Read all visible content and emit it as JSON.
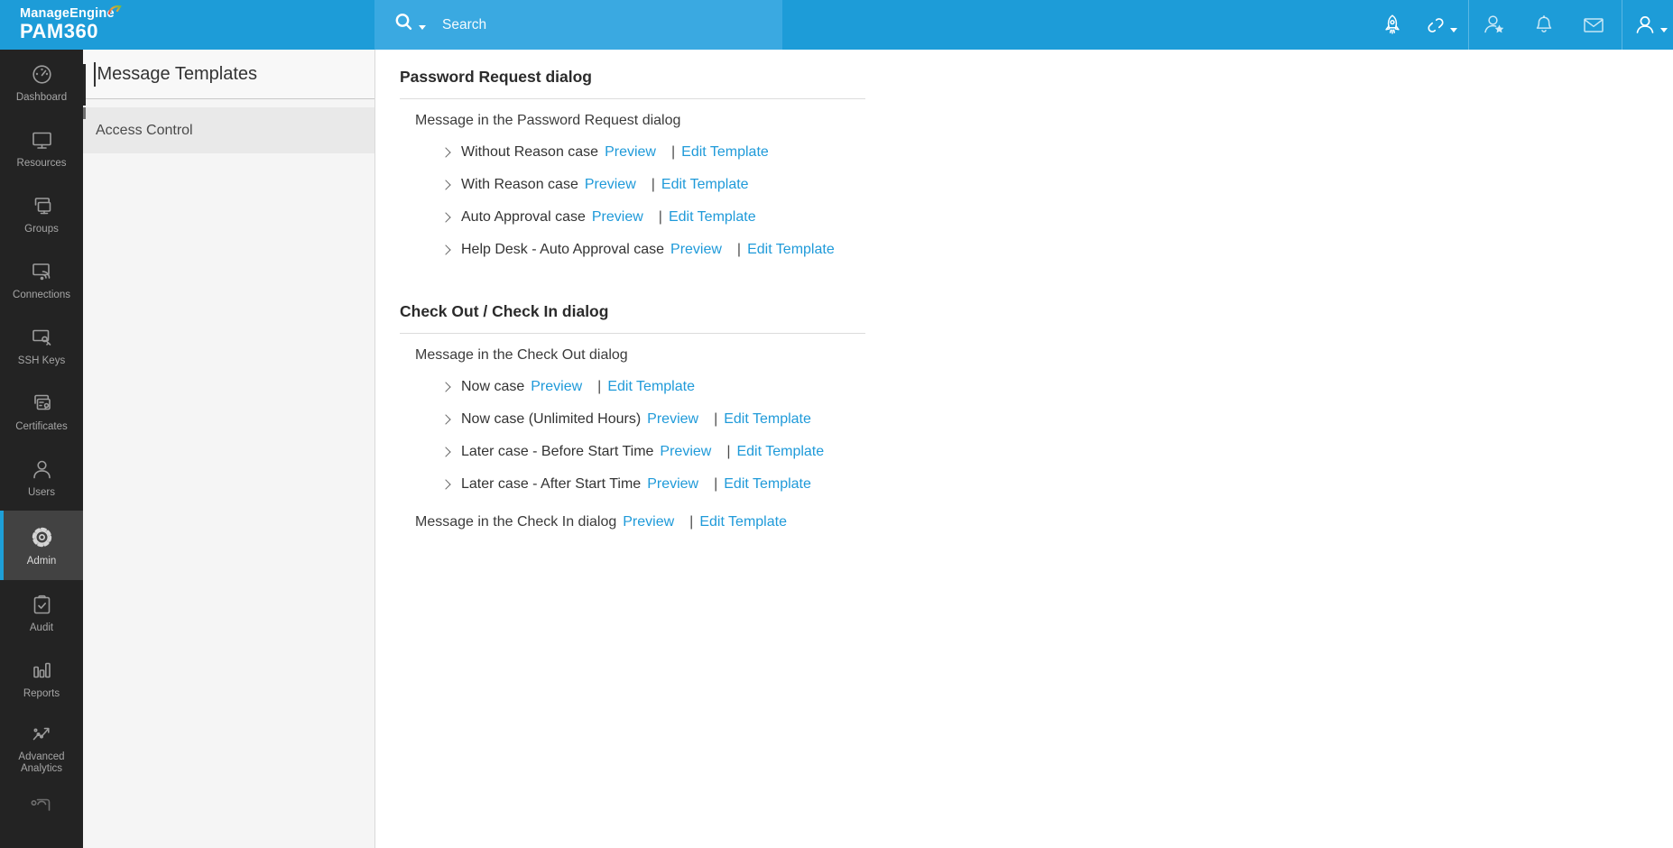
{
  "topbar": {
    "brand": "ManageEngine",
    "product": "PAM360",
    "search_placeholder": "Search",
    "right_icons": [
      {
        "id": "rocket",
        "icon": "rocket-icon",
        "caret": false,
        "dim": false
      },
      {
        "id": "link",
        "icon": "link-icon",
        "caret": true,
        "dim": false
      },
      {
        "id": "user-star",
        "icon": "user-star-icon",
        "caret": false,
        "dim": true
      },
      {
        "id": "bell",
        "icon": "bell-icon",
        "caret": false,
        "dim": true
      },
      {
        "id": "mail",
        "icon": "mail-icon",
        "caret": false,
        "dim": true
      },
      {
        "id": "profile",
        "icon": "profile-icon",
        "caret": true,
        "dim": false
      }
    ]
  },
  "sidebar": {
    "items": [
      {
        "id": "dashboard",
        "label": "Dashboard",
        "icon": "dashboard-icon",
        "active": false
      },
      {
        "id": "resources",
        "label": "Resources",
        "icon": "resources-icon",
        "active": false
      },
      {
        "id": "groups",
        "label": "Groups",
        "icon": "groups-icon",
        "active": false
      },
      {
        "id": "connections",
        "label": "Connections",
        "icon": "connections-icon",
        "active": false
      },
      {
        "id": "ssh-keys",
        "label": "SSH Keys",
        "icon": "ssh-keys-icon",
        "active": false
      },
      {
        "id": "certificates",
        "label": "Certificates",
        "icon": "certificates-icon",
        "active": false
      },
      {
        "id": "users",
        "label": "Users",
        "icon": "users-icon",
        "active": false
      },
      {
        "id": "admin",
        "label": "Admin",
        "icon": "admin-icon",
        "active": true
      },
      {
        "id": "audit",
        "label": "Audit",
        "icon": "audit-icon",
        "active": false
      },
      {
        "id": "reports",
        "label": "Reports",
        "icon": "reports-icon",
        "active": false
      },
      {
        "id": "advanced-analytics",
        "label": "Advanced Analytics",
        "icon": "advanced-analytics-icon",
        "active": false
      }
    ]
  },
  "panel": {
    "title": "Message Templates",
    "items": [
      {
        "label": "Access Control",
        "selected": true
      }
    ]
  },
  "links": {
    "preview": "Preview",
    "separator": "|",
    "edit": "Edit Template"
  },
  "sections": [
    {
      "title": "Password Request dialog",
      "groups": [
        {
          "intro": "Message in the Password Request dialog",
          "intro_links": false,
          "rows": [
            "Without Reason case",
            "With Reason case",
            "Auto Approval case",
            "Help Desk - Auto Approval case"
          ]
        }
      ]
    },
    {
      "title": "Check Out / Check In dialog",
      "groups": [
        {
          "intro": "Message in the Check Out dialog",
          "intro_links": false,
          "rows": [
            "Now case",
            "Now case (Unlimited Hours)",
            "Later case - Before Start Time",
            "Later case - After Start Time"
          ]
        },
        {
          "intro": "Message in the Check In dialog",
          "intro_links": true,
          "rows": []
        }
      ]
    }
  ],
  "colors": {
    "topbar_blue": "#1d9cd8",
    "search_blue": "#3aa9e1",
    "accent_blue": "#1e9fd8",
    "link_blue": "#1f9ad9",
    "sidebar_bg": "#232323",
    "sidebar_active_bg": "#424242",
    "panel_bg": "#f5f5f5",
    "panel_selected_bg": "#e9e9e9"
  }
}
